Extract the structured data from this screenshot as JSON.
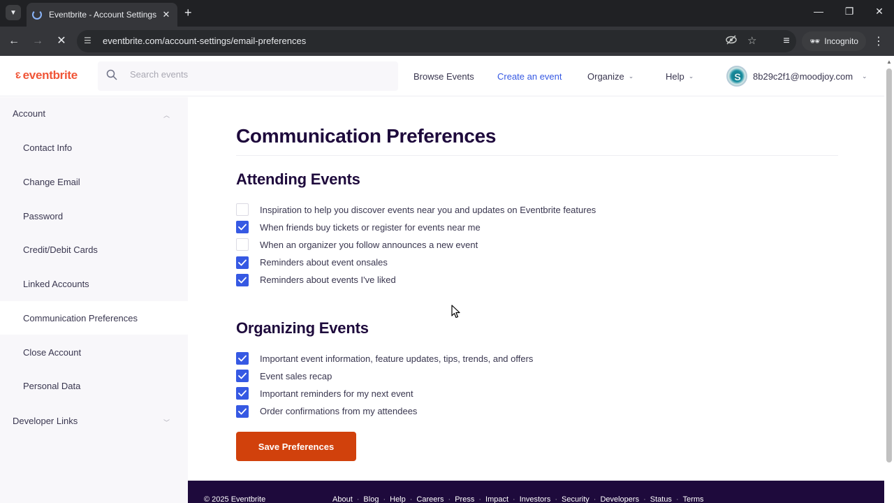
{
  "browser": {
    "tab_title": "Eventbrite - Account Settings",
    "tab_close": "✕",
    "new_tab": "+",
    "url": "eventbrite.com/account-settings/email-preferences",
    "incognito_label": "Incognito",
    "controls": {
      "minimize": "—",
      "restore": "❐",
      "close": "✕"
    }
  },
  "header": {
    "logo_text": "eventbrite",
    "search_placeholder": "Search events",
    "nav": {
      "browse": "Browse Events",
      "create": "Create an event",
      "organize": "Organize",
      "help": "Help"
    },
    "user_email": "8b29c2f1@moodjoy.com",
    "avatar_letter": "S"
  },
  "sidebar": {
    "account_label": "Account",
    "items": [
      {
        "label": "Contact Info"
      },
      {
        "label": "Change Email"
      },
      {
        "label": "Password"
      },
      {
        "label": "Credit/Debit Cards"
      },
      {
        "label": "Linked Accounts"
      },
      {
        "label": "Communication Preferences",
        "active": true
      },
      {
        "label": "Close Account"
      },
      {
        "label": "Personal Data"
      }
    ],
    "developer_label": "Developer Links"
  },
  "main": {
    "title": "Communication Preferences",
    "attending": {
      "title": "Attending Events",
      "prefs": [
        {
          "label": "Inspiration to help you discover events near you and updates on Eventbrite features",
          "checked": false
        },
        {
          "label": "When friends buy tickets or register for events near me",
          "checked": true
        },
        {
          "label": "When an organizer you follow announces a new event",
          "checked": false
        },
        {
          "label": "Reminders about event onsales",
          "checked": true
        },
        {
          "label": "Reminders about events I've liked",
          "checked": true
        }
      ]
    },
    "organizing": {
      "title": "Organizing Events",
      "prefs": [
        {
          "label": "Important event information, feature updates, tips, trends, and offers",
          "checked": true
        },
        {
          "label": "Event sales recap",
          "checked": true
        },
        {
          "label": "Important reminders for my next event",
          "checked": true
        },
        {
          "label": "Order confirmations from my attendees",
          "checked": true
        }
      ]
    },
    "save_label": "Save Preferences"
  },
  "footer": {
    "copyright": "© 2025 Eventbrite",
    "links": [
      "About",
      "Blog",
      "Help",
      "Careers",
      "Press",
      "Impact",
      "Investors",
      "Security",
      "Developers",
      "Status",
      "Terms"
    ]
  },
  "colors": {
    "brand": "#f05537",
    "checkbox_checked": "#3659e3",
    "save_button": "#d1410c",
    "footer_bg": "#1e0a3c"
  }
}
